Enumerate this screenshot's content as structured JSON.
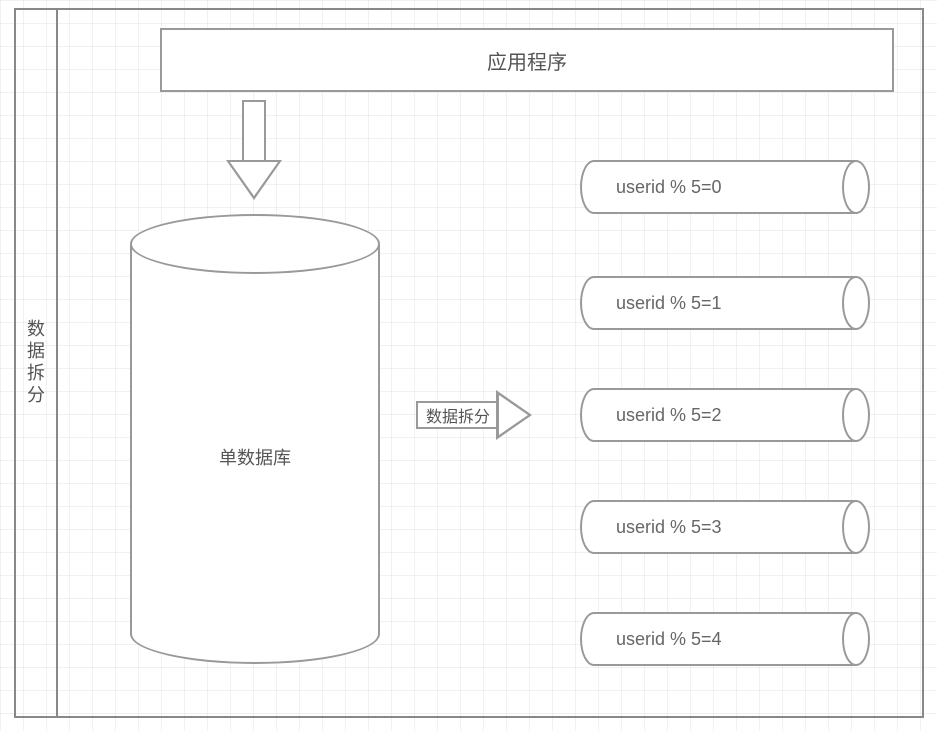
{
  "frame": {
    "title": "数据拆分"
  },
  "app_box": {
    "label": "应用程序"
  },
  "single_db": {
    "label": "单数据库"
  },
  "split_arrow": {
    "label": "数据拆分"
  },
  "shards": [
    {
      "label": "userid % 5=0"
    },
    {
      "label": "userid % 5=1"
    },
    {
      "label": "userid % 5=2"
    },
    {
      "label": "userid % 5=3"
    },
    {
      "label": "userid % 5=4"
    }
  ],
  "chart_data": {
    "type": "diagram",
    "title": "数据拆分",
    "description": "Application writes to a single database; data is split (数据拆分) into 5 shards based on userid % 5.",
    "nodes": [
      {
        "id": "app",
        "label": "应用程序",
        "kind": "process"
      },
      {
        "id": "single_db",
        "label": "单数据库",
        "kind": "database"
      },
      {
        "id": "shard0",
        "label": "userid % 5=0",
        "kind": "database-shard"
      },
      {
        "id": "shard1",
        "label": "userid % 5=1",
        "kind": "database-shard"
      },
      {
        "id": "shard2",
        "label": "userid % 5=2",
        "kind": "database-shard"
      },
      {
        "id": "shard3",
        "label": "userid % 5=3",
        "kind": "database-shard"
      },
      {
        "id": "shard4",
        "label": "userid % 5=4",
        "kind": "database-shard"
      }
    ],
    "edges": [
      {
        "from": "app",
        "to": "single_db",
        "label": ""
      },
      {
        "from": "single_db",
        "to": "shard0",
        "label": "数据拆分"
      },
      {
        "from": "single_db",
        "to": "shard1",
        "label": "数据拆分"
      },
      {
        "from": "single_db",
        "to": "shard2",
        "label": "数据拆分"
      },
      {
        "from": "single_db",
        "to": "shard3",
        "label": "数据拆分"
      },
      {
        "from": "single_db",
        "to": "shard4",
        "label": "数据拆分"
      }
    ],
    "shard_key": "userid",
    "shard_count": 5,
    "shard_rule": "userid % 5"
  }
}
